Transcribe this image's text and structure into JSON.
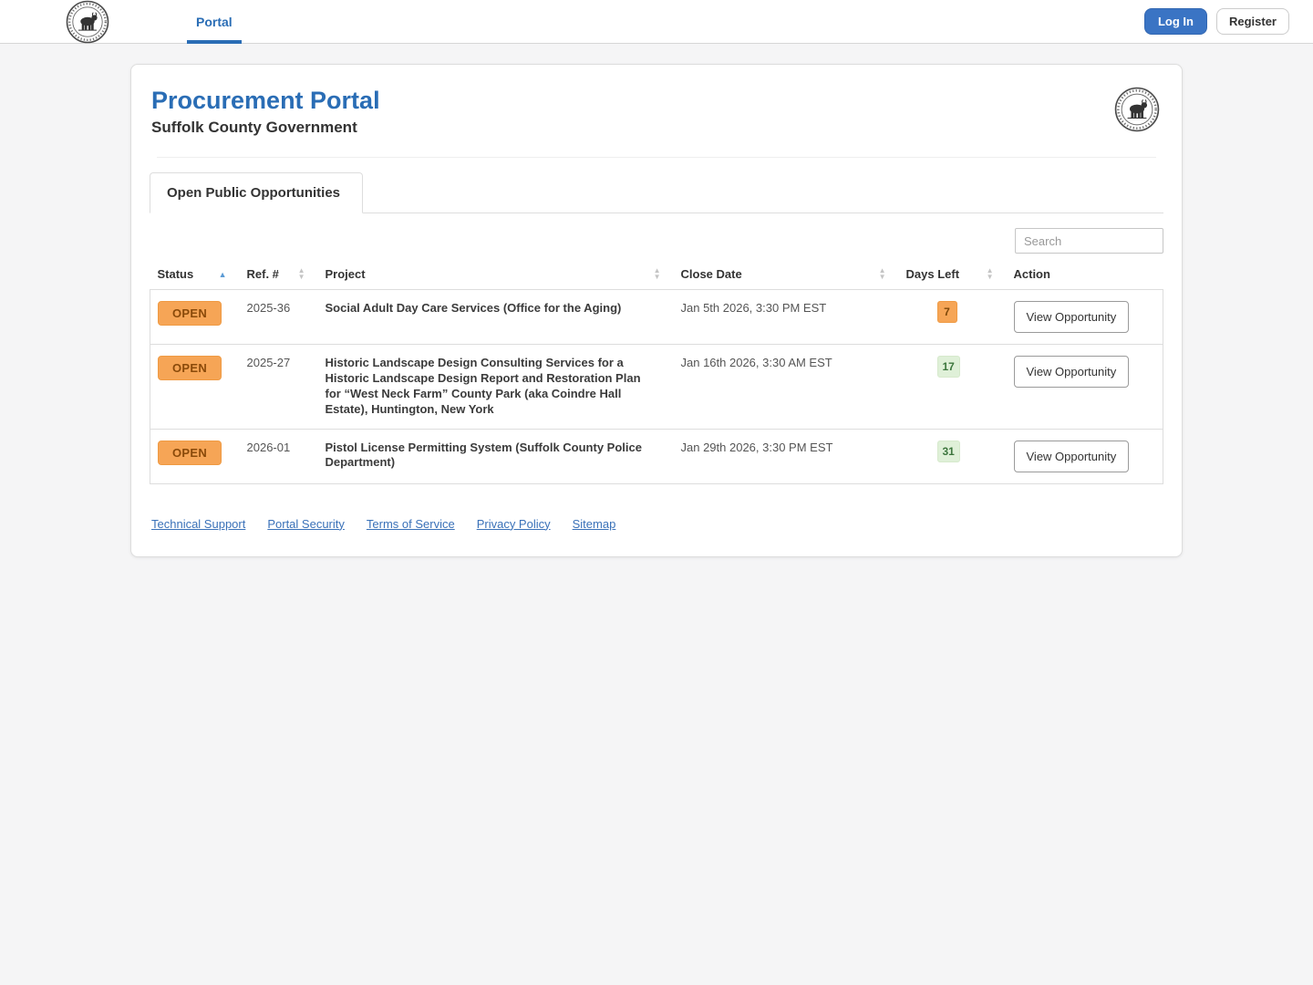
{
  "topbar": {
    "nav_portal": "Portal",
    "login_label": "Log In",
    "register_label": "Register"
  },
  "header": {
    "title": "Procurement Portal",
    "subtitle": "Suffolk County Government"
  },
  "tab": {
    "label": "Open Public Opportunities"
  },
  "search": {
    "placeholder": "Search"
  },
  "table": {
    "columns": [
      {
        "label": "Status",
        "sort": "asc"
      },
      {
        "label": "Ref. #",
        "sort": "none"
      },
      {
        "label": "Project",
        "sort": "none"
      },
      {
        "label": "Close Date",
        "sort": "none"
      },
      {
        "label": "Days Left",
        "sort": "none"
      },
      {
        "label": "Action",
        "sort": null
      }
    ],
    "rows": [
      {
        "status": "OPEN",
        "ref": "2025-36",
        "project": "Social Adult Day Care Services (Office for the Aging)",
        "close_date": "Jan 5th 2026, 3:30 PM EST",
        "days_left": "7",
        "days_variant": "orange",
        "action_label": "View Opportunity"
      },
      {
        "status": "OPEN",
        "ref": "2025-27",
        "project": "Historic Landscape Design Consulting Services for a Historic Landscape Design Report and Restoration Plan for “West Neck Farm” County Park (aka Coindre Hall Estate), Huntington, New York",
        "close_date": "Jan 16th 2026, 3:30 AM EST",
        "days_left": "17",
        "days_variant": "green",
        "action_label": "View Opportunity"
      },
      {
        "status": "OPEN",
        "ref": "2026-01",
        "project": "Pistol License Permitting System (Suffolk County Police Department)",
        "close_date": "Jan 29th 2026, 3:30 PM EST",
        "days_left": "31",
        "days_variant": "green",
        "action_label": "View Opportunity"
      }
    ]
  },
  "footer": {
    "links": [
      "Technical Support",
      "Portal Security",
      "Terms of Service",
      "Privacy Policy",
      "Sitemap"
    ]
  },
  "colors": {
    "accent_blue": "#2a6db5",
    "badge_orange": "#f6a556",
    "badge_green_bg": "#dff0d8",
    "badge_green_text": "#3c763d"
  }
}
